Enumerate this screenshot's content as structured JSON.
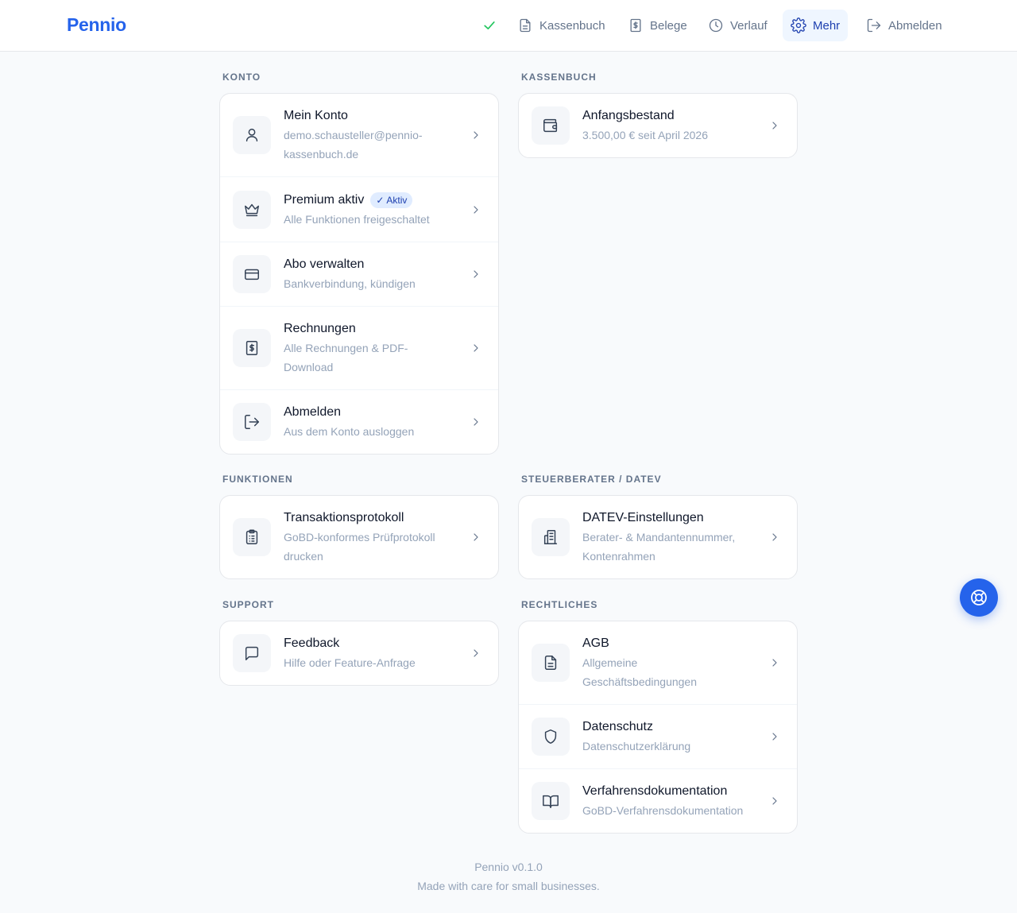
{
  "app": {
    "name": "Pennio"
  },
  "nav": {
    "items": [
      {
        "label": "Kassenbuch",
        "icon": "document-icon"
      },
      {
        "label": "Belege",
        "icon": "receipt-icon"
      },
      {
        "label": "Verlauf",
        "icon": "clock-icon"
      },
      {
        "label": "Mehr",
        "icon": "gear-icon",
        "active": true
      },
      {
        "label": "Abmelden",
        "icon": "logout-icon"
      }
    ],
    "status_icon": "check-icon"
  },
  "sections": {
    "konto": {
      "label": "KONTO",
      "items": [
        {
          "title": "Mein Konto",
          "subtitle": "demo.schausteller@pennio-kassenbuch.de",
          "icon": "user-icon"
        },
        {
          "title": "Premium aktiv",
          "badge": "Aktiv",
          "subtitle": "Alle Funktionen freigeschaltet",
          "icon": "crown-icon"
        },
        {
          "title": "Abo verwalten",
          "subtitle": "Bankverbindung, kündigen",
          "icon": "credit-card-icon"
        },
        {
          "title": "Rechnungen",
          "subtitle": "Alle Rechnungen & PDF-Download",
          "icon": "invoice-icon"
        },
        {
          "title": "Abmelden",
          "subtitle": "Aus dem Konto ausloggen",
          "icon": "logout-icon"
        }
      ]
    },
    "kassenbuch": {
      "label": "KASSENBUCH",
      "items": [
        {
          "title": "Anfangsbestand",
          "subtitle": "3.500,00 € seit April 2026",
          "icon": "wallet-icon"
        }
      ]
    },
    "funktionen": {
      "label": "FUNKTIONEN",
      "items": [
        {
          "title": "Transaktionsprotokoll",
          "subtitle": "GoBD-konformes Prüfprotokoll drucken",
          "icon": "clipboard-icon"
        }
      ]
    },
    "steuerberater": {
      "label": "STEUERBERATER / DATEV",
      "items": [
        {
          "title": "DATEV-Einstellungen",
          "subtitle": "Berater- & Mandantennummer, Kontenrahmen",
          "icon": "building-icon"
        }
      ]
    },
    "support": {
      "label": "SUPPORT",
      "items": [
        {
          "title": "Feedback",
          "subtitle": "Hilfe oder Feature-Anfrage",
          "icon": "message-icon"
        }
      ]
    },
    "rechtliches": {
      "label": "RECHTLICHES",
      "items": [
        {
          "title": "AGB",
          "subtitle": "Allgemeine Geschäftsbedingungen",
          "icon": "document-icon"
        },
        {
          "title": "Datenschutz",
          "subtitle": "Datenschutzerklärung",
          "icon": "shield-icon"
        },
        {
          "title": "Verfahrensdokumentation",
          "subtitle": "GoBD-Verfahrensdokumentation",
          "icon": "book-icon"
        }
      ]
    }
  },
  "footer": {
    "version": "Pennio v0.1.0",
    "tagline": "Made with care for small businesses."
  },
  "help_button": {
    "icon": "lifebuoy-icon"
  },
  "colors": {
    "brand": "#2563eb",
    "success": "#22c55e",
    "muted": "#94a3b8"
  }
}
